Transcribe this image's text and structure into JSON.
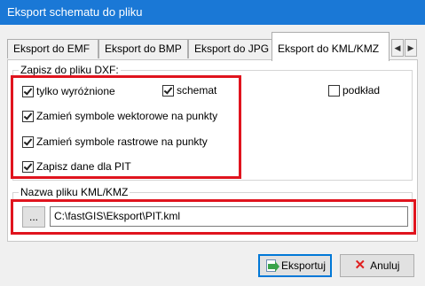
{
  "window": {
    "title": "Eksport schematu do pliku"
  },
  "tabs": [
    {
      "label": "Eksport do EMF"
    },
    {
      "label": "Eksport do BMP"
    },
    {
      "label": "Eksport do JPG"
    },
    {
      "label": "Eksport do KML/KMZ",
      "active": true
    }
  ],
  "tab_scroll": {
    "left": "◀",
    "right": "▶"
  },
  "dxf_group": {
    "legend": "Zapisz do pliku DXF:",
    "only_highlighted": {
      "label": "tylko wyróżnione",
      "checked": true
    },
    "schema": {
      "label": "schemat",
      "checked": true
    },
    "background": {
      "label": "podkład",
      "checked": false
    },
    "vector_to_points": {
      "label": "Zamień symbole wektorowe na punkty",
      "checked": true
    },
    "raster_to_points": {
      "label": "Zamień symbole rastrowe na punkty",
      "checked": true
    },
    "save_pit": {
      "label": "Zapisz dane dla PIT",
      "checked": true
    }
  },
  "file_group": {
    "legend": "Nazwa pliku KML/KMZ",
    "browse_label": "...",
    "path": "C:\\fastGIS\\Eksport\\PIT.kml"
  },
  "buttons": {
    "export": "Eksportuj",
    "cancel": "Anuluj"
  },
  "colors": {
    "titlebar": "#1a78d6",
    "highlight": "#e0141e"
  }
}
